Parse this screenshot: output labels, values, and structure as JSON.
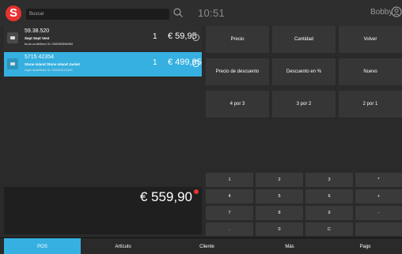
{
  "header": {
    "logo": "S",
    "search_placeholder": "Buscar",
    "time": "10:51",
    "user": "Bobby"
  },
  "cart": {
    "items": [
      {
        "code": "59.38.520",
        "name": "Sept Sept Vest",
        "detail": "bruin undefined XL 000050596992",
        "qty": "1",
        "price": "€ 59,95",
        "selected": false
      },
      {
        "code": "5715 42354",
        "name": "Stone Island Stone Island Jacket",
        "detail": "royal undefined XL 000053141182",
        "qty": "1",
        "price": "€ 499,95",
        "selected": true
      }
    ],
    "total": "€ 559,90"
  },
  "actions": {
    "row1": [
      "Precio",
      "Cantidad",
      "Volver"
    ],
    "row2": [
      "Precio de descuento",
      "Descuento en %",
      "Nuevo"
    ],
    "row3": [
      "4 por 3",
      "3 por 2",
      "2 por 1"
    ]
  },
  "keypad": {
    "rows": [
      [
        "1",
        "2",
        "3",
        "*"
      ],
      [
        "4",
        "5",
        "6",
        "+"
      ],
      [
        "7",
        "8",
        "9",
        "-"
      ],
      [
        ".",
        "0",
        "C",
        ""
      ]
    ]
  },
  "nav": {
    "tabs": [
      "POS",
      "Artículo",
      "Cliente",
      "Más",
      "Pago"
    ],
    "active": 0
  },
  "colors": {
    "accent": "#36b0e0",
    "brand": "#e8322f"
  }
}
